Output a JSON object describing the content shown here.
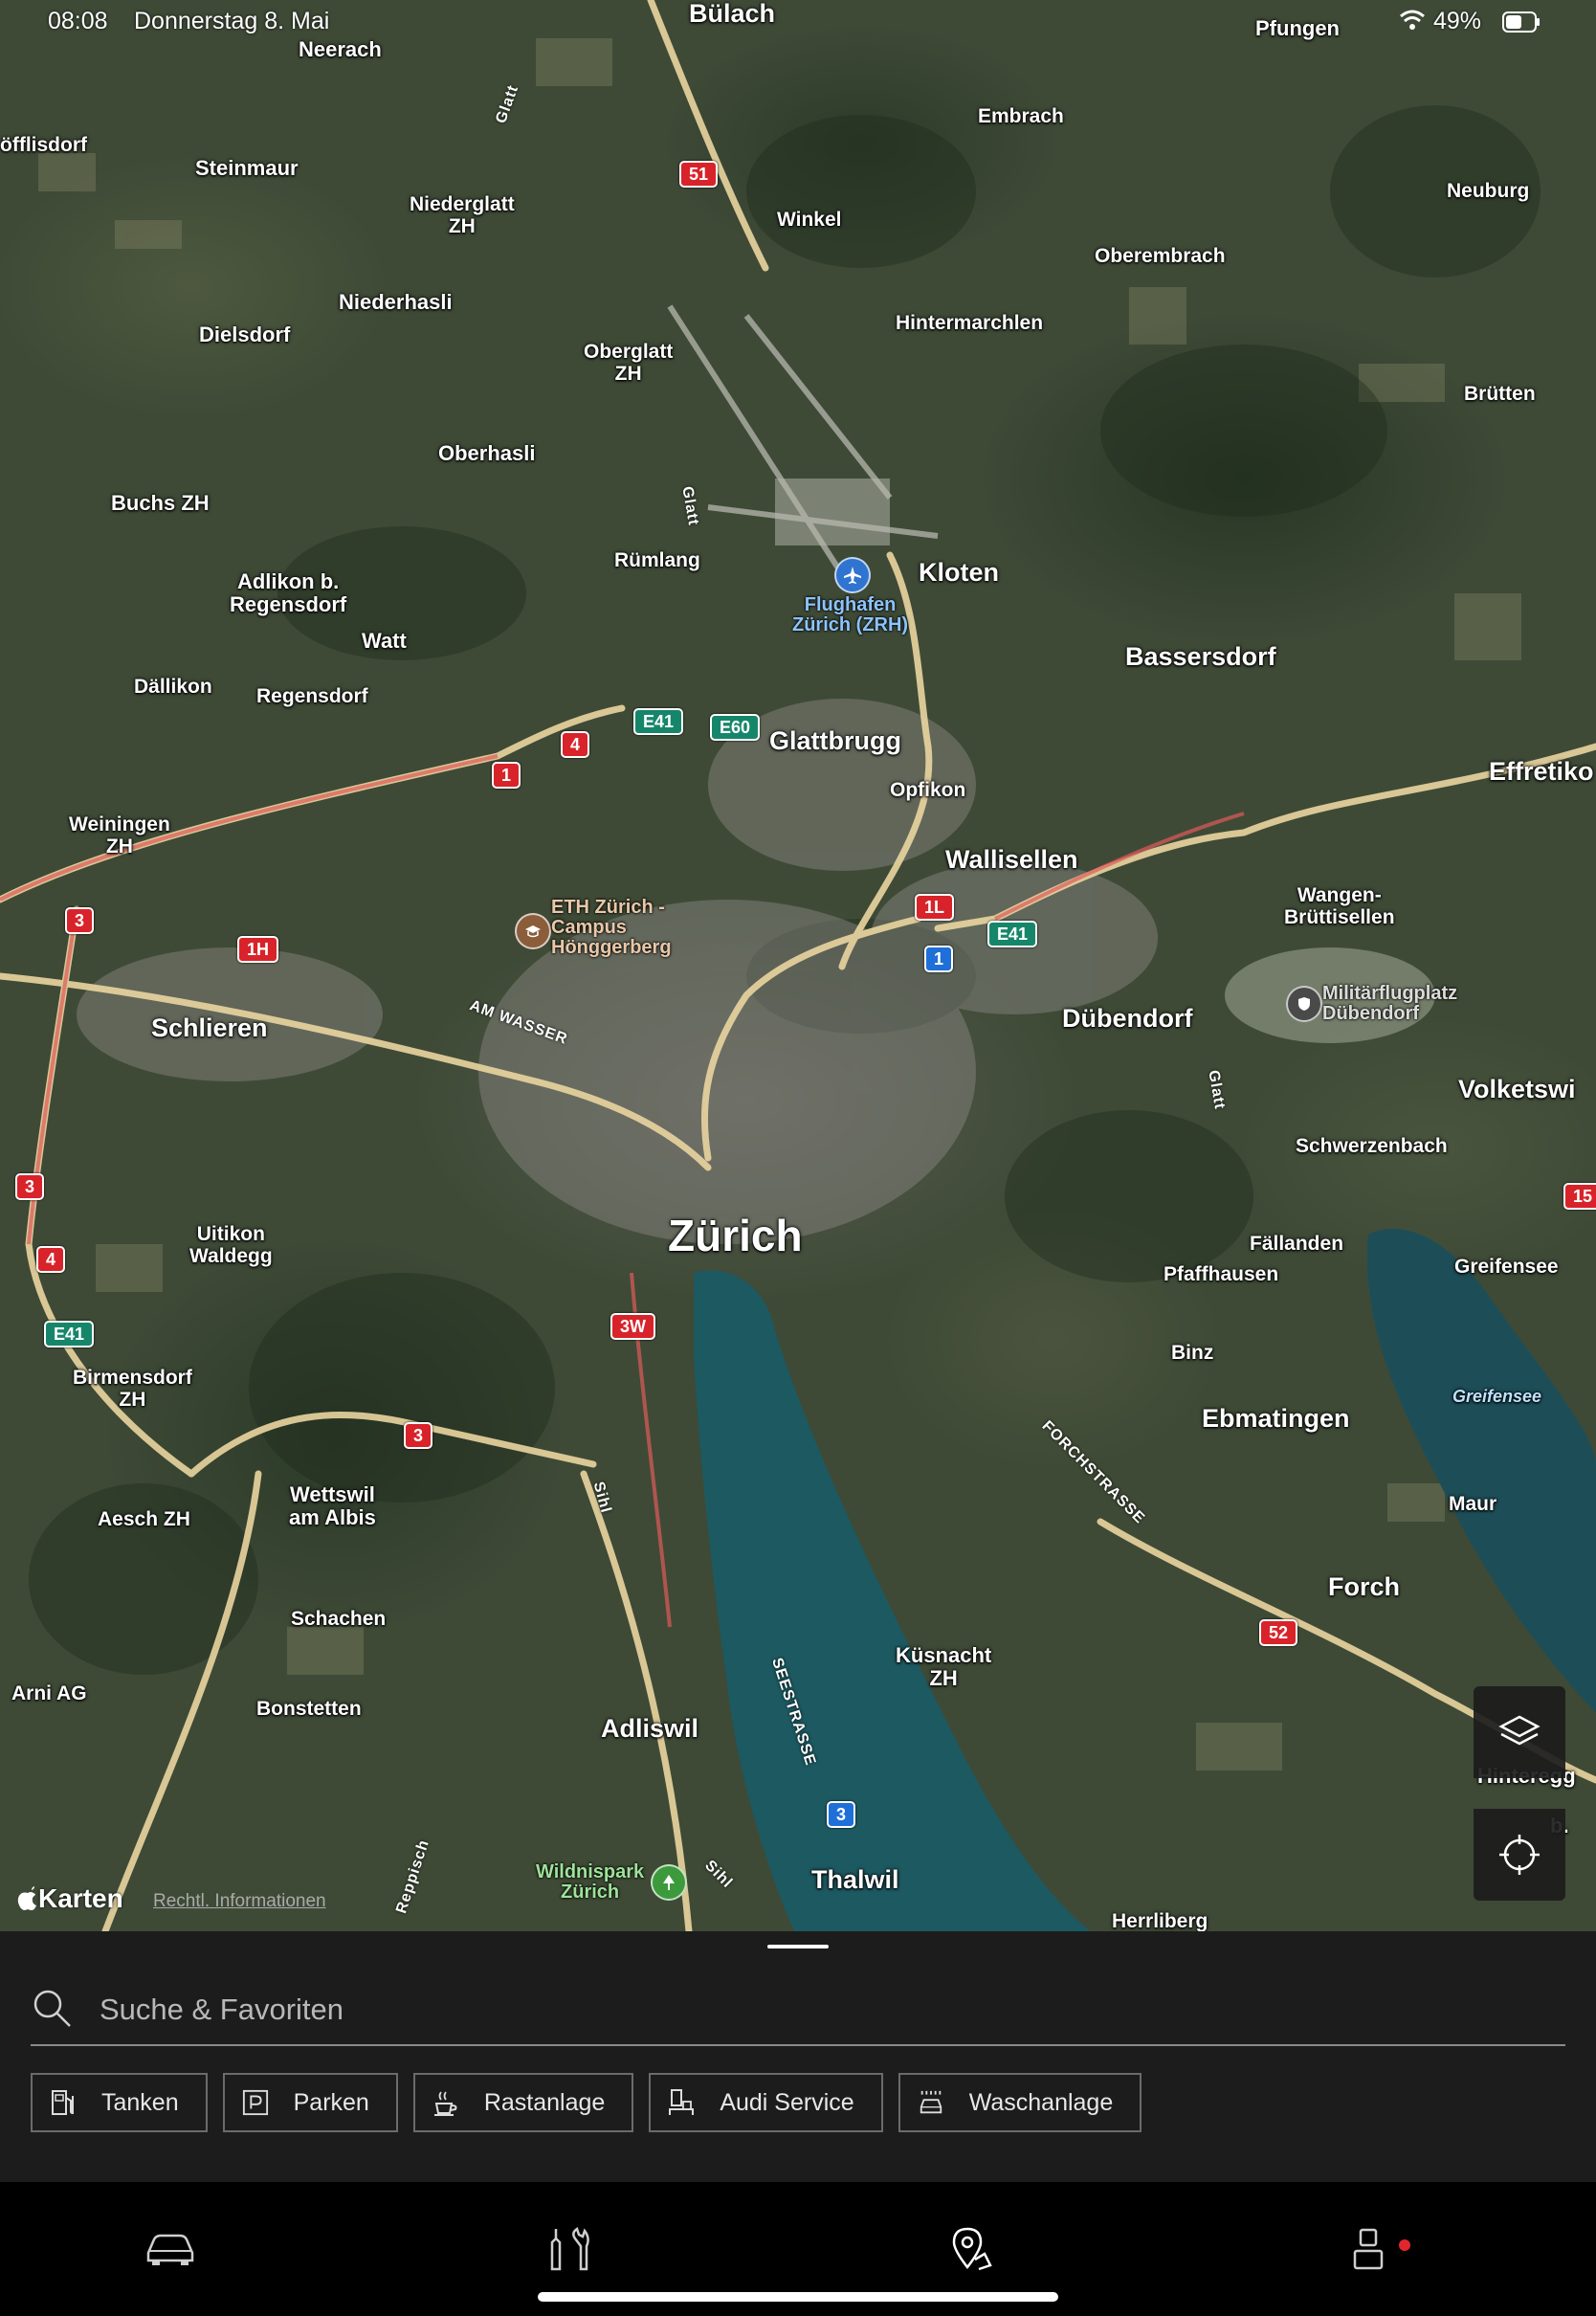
{
  "status_bar": {
    "time": "08:08",
    "date": "Donnerstag 8. Mai",
    "battery": "49%"
  },
  "map": {
    "places": {
      "buelach": "Bülach",
      "neerach": "Neerach",
      "pfungen": "Pfungen",
      "hoefflisdorf": "öfflisdorf",
      "embrach": "Embrach",
      "steinmaur": "Steinmaur",
      "niederglatt": "Niederglatt\nZH",
      "winkel": "Winkel",
      "neuburg": "Neuburg",
      "oberembrach": "Oberembrach",
      "dielsdorf": "Dielsdorf",
      "niederhasli": "Niederhasli",
      "hintermarchlen": "Hintermarchlen",
      "oberglatt": "Oberglatt\nZH",
      "bruetten": "Brütten",
      "oberhasli": "Oberhasli",
      "buchs": "Buchs ZH",
      "ruemlang": "Rümlang",
      "kloten": "Kloten",
      "adlikon": "Adlikon b.\nRegensdorf",
      "watt": "Watt",
      "bassersdorf": "Bassersdorf",
      "daellikon": "Dällikon",
      "regensdorf": "Regensdorf",
      "glattbrugg": "Glattbrugg",
      "effretikon": "Effretiko",
      "opfikon": "Opfikon",
      "weiningen": "Weiningen\nZH",
      "wallisellen": "Wallisellen",
      "wangen": "Wangen-\nBrüttisellen",
      "schlieren": "Schlieren",
      "duebendorf": "Dübendorf",
      "volketswil": "Volketswi",
      "schwerzenbach": "Schwerzenbach",
      "zuerich": "Zürich",
      "uitikon": "Uitikon\nWaldegg",
      "faellanden": "Fällanden",
      "pfaffhausen": "Pfaffhausen",
      "greifensee": "Greifensee",
      "binz": "Binz",
      "birmensdorf": "Birmensdorf\nZH",
      "ebmatingen": "Ebmatingen",
      "wettswil": "Wettswil\nam Albis",
      "aesch": "Aesch ZH",
      "maur": "Maur",
      "forch": "Forch",
      "schachen": "Schachen",
      "kuesnacht": "Küsnacht\nZH",
      "arni": "Arni AG",
      "bonstetten": "Bonstetten",
      "adliswil": "Adliswil",
      "hinteregg": "Hinteregg",
      "thalwil": "Thalwil",
      "herrliberg": "Herrliberg",
      "partial_b": "b.",
      "lake_greifensee": "Greifensee"
    },
    "roads": {
      "glatt1": "Glatt",
      "glatt2": "Glatt",
      "glatt3": "Glatt",
      "am_wasser": "AM WASSER",
      "forchstrasse": "FORCHSTRASSE",
      "seestrasse": "SEESTRASSE",
      "sihl1": "Sihl",
      "sihl2": "Sihl",
      "reppisch": "Reppisch"
    },
    "shields": {
      "s51": "51",
      "s4a": "4",
      "s1a": "1",
      "e41a": "E41",
      "e60": "E60",
      "s3a": "3",
      "s1h": "1H",
      "s1l": "1L",
      "s1b": "1",
      "e41b": "E41",
      "s3b": "3",
      "s4b": "4",
      "e41c": "E41",
      "s3w": "3W",
      "s3c": "3",
      "s15": "15",
      "s52": "52",
      "s3d": "3"
    },
    "pois": {
      "airport": "Flughafen\nZürich (ZRH)",
      "eth": "ETH Zürich -\nCampus\nHönggerberg",
      "militaer": "Militärflugplatz\nDübendorf",
      "wildnispark": "Wildnispark\nZürich"
    },
    "attribution": {
      "brand": "Karten",
      "legal": "Rechtl. Informationen"
    },
    "controls": {
      "layers_icon": "layers-icon",
      "locate_icon": "crosshair-icon"
    }
  },
  "sheet": {
    "search_placeholder": "Suche & Favoriten",
    "chips": [
      {
        "label": "Tanken",
        "icon": "fuel-pump-icon"
      },
      {
        "label": "Parken",
        "icon": "parking-icon"
      },
      {
        "label": "Rastanlage",
        "icon": "coffee-cup-icon"
      },
      {
        "label": "Audi Service",
        "icon": "service-icon"
      },
      {
        "label": "Waschanlage",
        "icon": "car-wash-icon"
      }
    ]
  },
  "tabbar": {
    "tabs": [
      {
        "name": "vehicle",
        "icon": "car-icon"
      },
      {
        "name": "services",
        "icon": "tools-icon"
      },
      {
        "name": "map",
        "icon": "map-pin-icon"
      },
      {
        "name": "profile",
        "icon": "person-icon",
        "badge": true
      }
    ],
    "badge_color": "#e3262e"
  },
  "colors": {
    "lake": "#1d5961",
    "highway": "#ead5a0",
    "motorway_red": "#d8232a"
  }
}
